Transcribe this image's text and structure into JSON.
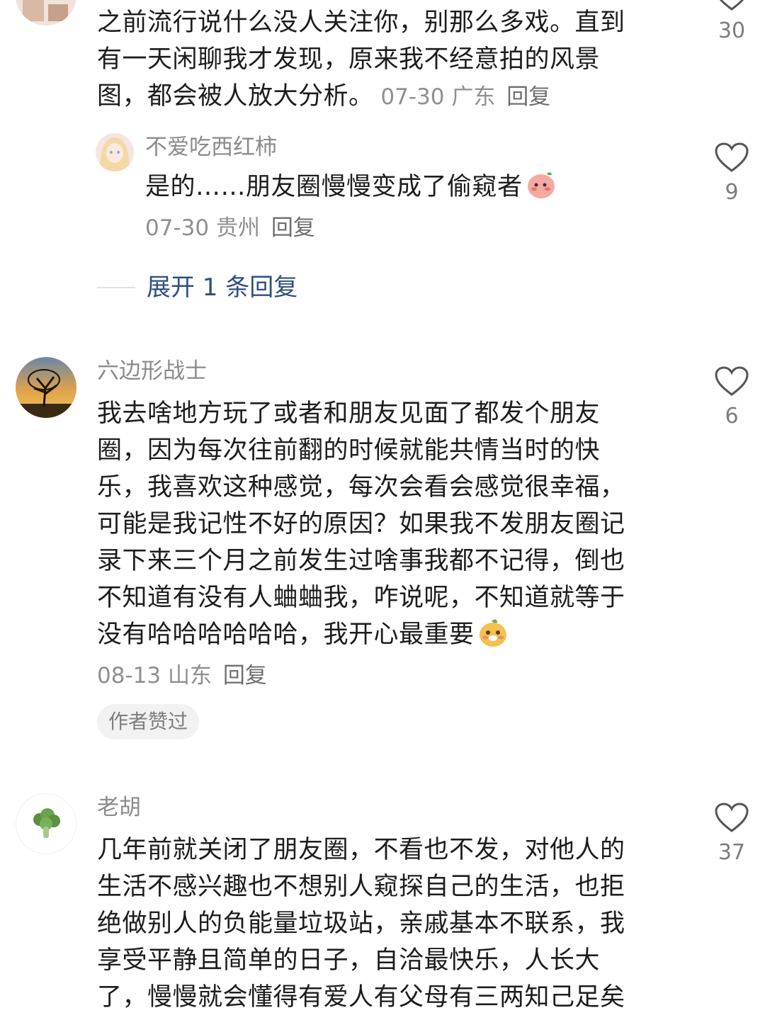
{
  "comments": [
    {
      "text_lines": [
        "之前流行说什么没人关注你，别那么多戏。直到",
        "有一天闲聊我才发现，原来我不经意拍的风景",
        "图，都会被人放大分析。"
      ],
      "date": "07-30",
      "location": "广东",
      "reply_label": "回复",
      "likes": "30",
      "sub_reply": {
        "name": "不爱吃西红柿",
        "text": "是的……朋友圈慢慢变成了偷窥者",
        "date": "07-30",
        "location": "贵州",
        "reply_label": "回复",
        "likes": "9"
      },
      "expand_label": "展开 1 条回复"
    },
    {
      "name": "六边形战士",
      "text_lines": [
        "我去啥地方玩了或者和朋友见面了都发个朋友",
        "圈，因为每次往前翻的时候就能共情当时的快",
        "乐，我喜欢这种感觉，每次会看会感觉很幸福，",
        "可能是我记性不好的原因？如果我不发朋友圈记",
        "录下来三个月之前发生过啥事我都不记得，倒也",
        "不知道有没有人蛐蛐我，咋说呢，不知道就等于",
        "没有哈哈哈哈哈哈，我开心最重要"
      ],
      "date": "08-13",
      "location": "山东",
      "reply_label": "回复",
      "likes": "6",
      "badge": "作者赞过"
    },
    {
      "name": "老胡",
      "text_lines": [
        "几年前就关闭了朋友圈，不看也不发，对他人的",
        "生活不感兴趣也不想别人窥探自己的生活，也拒",
        "绝做别人的负能量垃圾站，亲戚基本不联系，我",
        "享受平静且简单的日子，自洽最快乐，人长大",
        "了，慢慢就会懂得有爱人有父母有三两知己足矣"
      ],
      "likes": "37"
    }
  ],
  "colors": {
    "link": "#2f4f7e",
    "meta": "#8f8f8f",
    "name": "#8b8b8b"
  }
}
